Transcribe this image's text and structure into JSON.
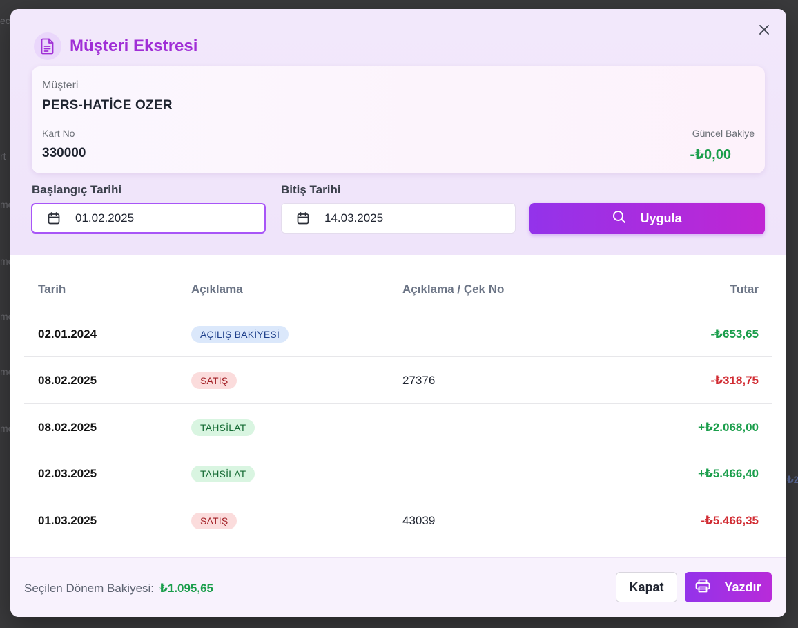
{
  "backdrop": {
    "fragments": [
      "ec",
      "rt",
      "me",
      "me",
      "me",
      "me",
      "me",
      "₺2"
    ]
  },
  "modal": {
    "title": "Müşteri Ekstresi",
    "icon": "document-icon",
    "close_icon": "close-icon"
  },
  "customer": {
    "label": "Müşteri",
    "name": "PERS-HATİCE OZER",
    "card_label": "Kart No",
    "card_no": "330000",
    "balance_label": "Güncel Bakiye",
    "balance_value": "-₺0,00",
    "balance_color": "#1a9e4b"
  },
  "filters": {
    "start_label": "Başlangıç Tarihi",
    "start_value": "01.02.2025",
    "end_label": "Bitiş Tarihi",
    "end_value": "14.03.2025",
    "apply_label": "Uygula"
  },
  "table": {
    "headers": [
      "Tarih",
      "Açıklama",
      "Açıklama / Çek No",
      "Tutar"
    ],
    "rows": [
      {
        "date": "02.01.2024",
        "type": "AÇILIŞ BAKİYESİ",
        "type_kind": "opening",
        "no": "",
        "amount": "-₺653,65",
        "amount_kind": "pos"
      },
      {
        "date": "08.02.2025",
        "type": "SATIŞ",
        "type_kind": "sale",
        "no": "27376",
        "amount": "-₺318,75",
        "amount_kind": "neg"
      },
      {
        "date": "08.02.2025",
        "type": "TAHSİLAT",
        "type_kind": "collection",
        "no": "",
        "amount": "+₺2.068,00",
        "amount_kind": "pos"
      },
      {
        "date": "02.03.2025",
        "type": "TAHSİLAT",
        "type_kind": "collection",
        "no": "",
        "amount": "+₺5.466,40",
        "amount_kind": "pos"
      },
      {
        "date": "01.03.2025",
        "type": "SATIŞ",
        "type_kind": "sale",
        "no": "43039",
        "amount": "-₺5.466,35",
        "amount_kind": "neg"
      }
    ]
  },
  "badge_colors": {
    "opening": {
      "bg": "#dbe8fb",
      "fg": "#1e3f8a"
    },
    "sale": {
      "bg": "#fbdcdc",
      "fg": "#a11d23"
    },
    "collection": {
      "bg": "#d9f5e1",
      "fg": "#156b34"
    }
  },
  "footer": {
    "period_label": "Seçilen Dönem Bakiyesi:",
    "period_value": "₺1.095,65",
    "close_label": "Kapat",
    "print_label": "Yazdır"
  }
}
